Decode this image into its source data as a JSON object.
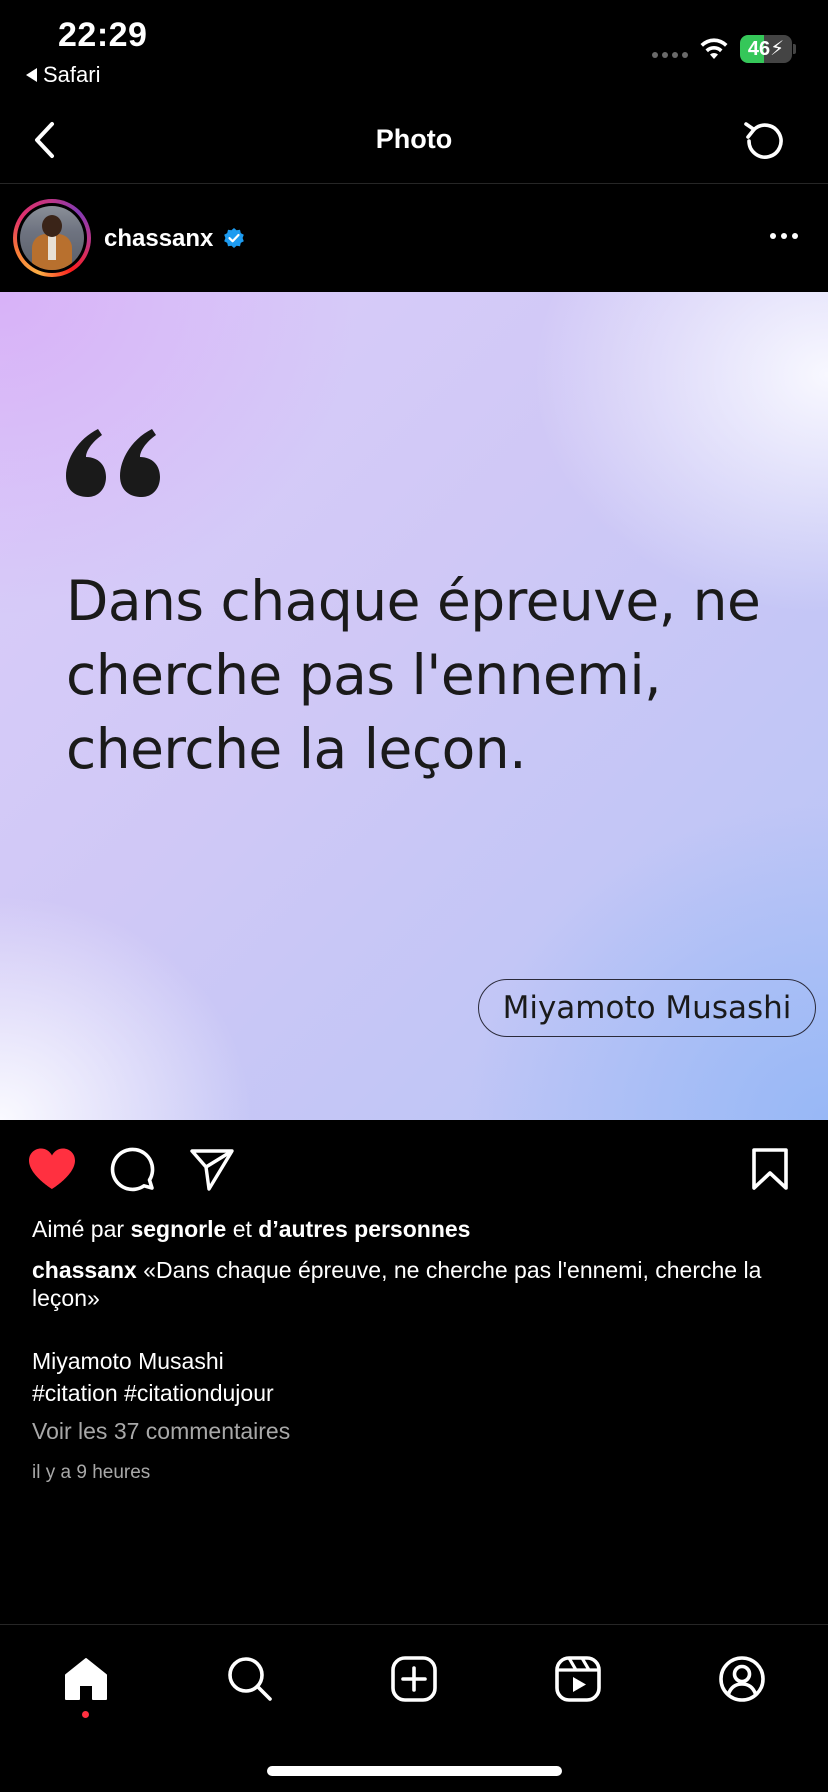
{
  "status_bar": {
    "time": "22:29",
    "back_app": "Safari",
    "battery_level": "46",
    "battery_color": "#35c759"
  },
  "nav": {
    "title": "Photo",
    "back_icon": "chevron-left-icon",
    "refresh_icon": "refresh-icon"
  },
  "post": {
    "username": "chassanx",
    "verified": true,
    "image": {
      "quote_text": "Dans chaque épreuve, ne cherche pas l'ennemi, cherche la leçon.",
      "author": "Miyamoto Musashi"
    },
    "liked": true,
    "like_color": "#ff3040",
    "likes": {
      "prefix": "Aimé par ",
      "user": "segnorle",
      "middle": " et ",
      "others": "d’autres personnes"
    },
    "caption": {
      "username": "chassanx",
      "text": " «Dans chaque épreuve, ne cherche pas l'ennemi, cherche la leçon»",
      "author_line": "Miyamoto Musashi",
      "hashtags": "#citation #citationdujour"
    },
    "comments_link": "Voir les 37 commentaires",
    "timestamp": "il y a 9 heures"
  },
  "tab_bar": {
    "items": [
      "home-icon",
      "search-icon",
      "create-icon",
      "reels-icon",
      "profile-icon"
    ],
    "active": "home-icon"
  }
}
